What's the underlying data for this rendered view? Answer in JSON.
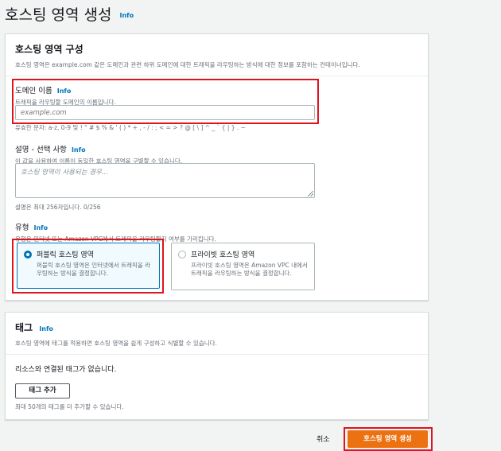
{
  "page": {
    "title": "호스팅 영역 생성",
    "info": "Info"
  },
  "config_panel": {
    "title": "호스팅 영역 구성",
    "description": "호스팅 영역은 example.com 같은 도메인과 관련 하위 도메인에 대한 트래픽을 라우팅하는 방식에 대한 정보를 포함하는 컨테이너입니다.",
    "domain": {
      "label": "도메인 이름",
      "info": "Info",
      "description": "트래픽을 라우팅할 도메인의 이름입니다.",
      "placeholder": "example.com",
      "constraint": "유효한 문자: a-z, 0-9 및 ! \" # $ % & ' ( ) * + , - / : ; < = > ? @ [ \\ ] ^ _ ` { | } . ~"
    },
    "description_field": {
      "label": "설명 - 선택 사항",
      "info": "Info",
      "description": "이 값을 사용하여 이름이 동일한 호스팅 영역을 구별할 수 있습니다.",
      "placeholder": "호스팅 영역이 사용되는 경우...",
      "constraint": "설명은 최대 256자입니다. 0/256"
    },
    "type": {
      "label": "유형",
      "info": "Info",
      "description": "유형은 인터넷 또는 Amazon VPC에서 트래픽을 라우팅할지 여부를 가리킵니다.",
      "options": [
        {
          "title": "퍼블릭 호스팅 영역",
          "description": "퍼블릭 호스팅 영역은 인터넷에서 트래픽을 라우팅하는 방식을 결정합니다.",
          "selected": true
        },
        {
          "title": "프라이빗 호스팅 영역",
          "description": "프라이빗 호스팅 영역은 Amazon VPC 내에서 트래픽을 라우팅하는 방식을 결정합니다.",
          "selected": false
        }
      ]
    }
  },
  "tags_panel": {
    "title": "태그",
    "info": "Info",
    "description": "호스팅 영역에 태그를 적용하면 호스팅 영역을 쉽게 구성하고 식별할 수 있습니다.",
    "empty_text": "리소스와 연결된 태그가 없습니다.",
    "add_button": "태그 추가",
    "limit_text": "최대 50개의 태그를 더 추가할 수 있습니다."
  },
  "footer": {
    "cancel": "취소",
    "submit": "호스팅 영역 생성"
  },
  "colors": {
    "accent": "#0073bb",
    "primary_button": "#ec7211",
    "highlight": "#e0141e"
  }
}
